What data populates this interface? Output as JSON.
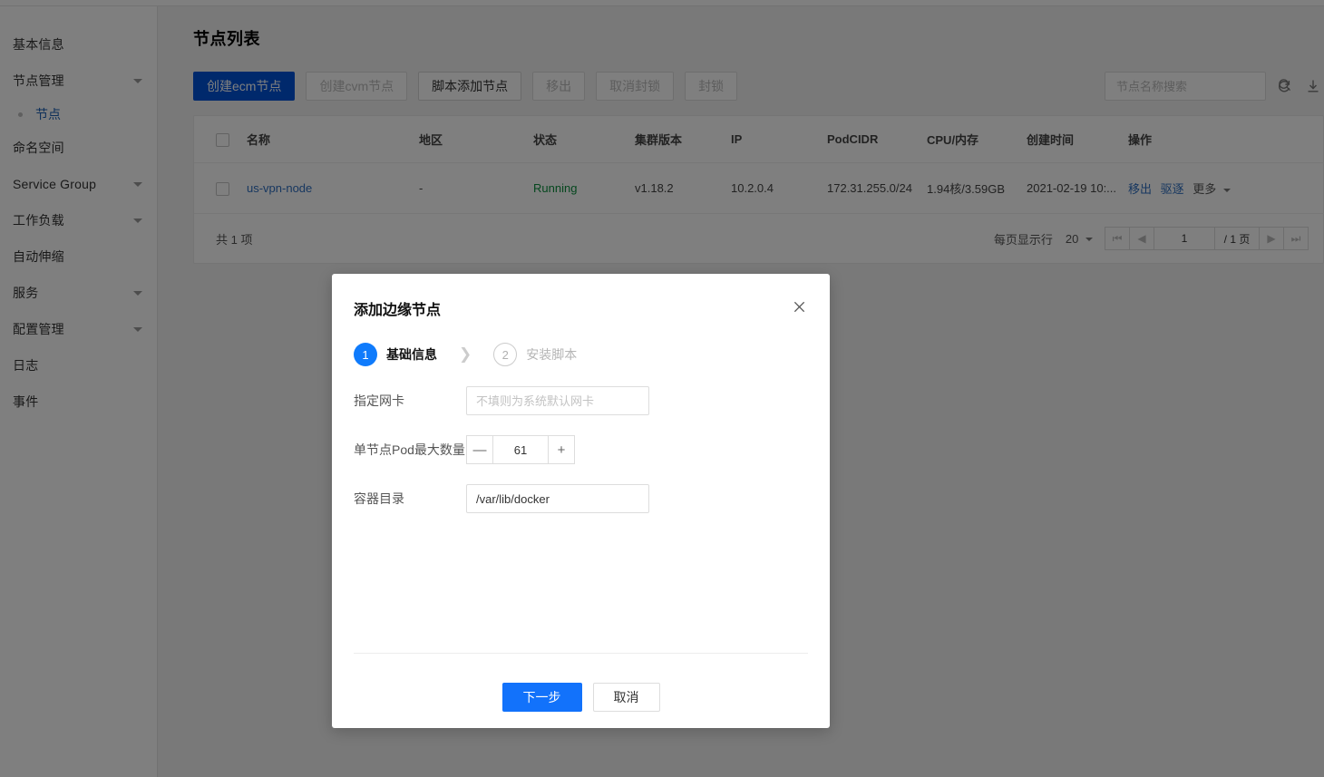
{
  "sidebar": {
    "items": [
      {
        "label": "基本信息",
        "has_caret": false
      },
      {
        "label": "节点管理",
        "has_caret": true
      },
      {
        "label": "命名空间",
        "has_caret": false
      },
      {
        "label": "Service Group",
        "has_caret": true
      },
      {
        "label": "工作负载",
        "has_caret": true
      },
      {
        "label": "自动伸缩",
        "has_caret": false
      },
      {
        "label": "服务",
        "has_caret": true
      },
      {
        "label": "配置管理",
        "has_caret": true
      },
      {
        "label": "日志",
        "has_caret": false
      },
      {
        "label": "事件",
        "has_caret": false
      }
    ],
    "sub_item": {
      "label": "节点"
    }
  },
  "page": {
    "title": "节点列表"
  },
  "toolbar": {
    "create_ecm": "创建ecm节点",
    "create_cvm": "创建cvm节点",
    "script_add": "脚本添加节点",
    "remove": "移出",
    "uncordon": "取消封锁",
    "cordon": "封锁"
  },
  "search": {
    "placeholder": "节点名称搜索",
    "value": "",
    "search_icon": "search-icon",
    "refresh_icon": "refresh-icon",
    "download_icon": "download-icon"
  },
  "table": {
    "columns": [
      "名称",
      "地区",
      "状态",
      "集群版本",
      "IP",
      "PodCIDR",
      "CPU/内存",
      "创建时间",
      "操作"
    ],
    "rows": [
      {
        "name": "us-vpn-node",
        "region": "-",
        "status": "Running",
        "version": "v1.18.2",
        "ip": "10.2.0.4",
        "podcidr": "172.31.255.0/24",
        "cpu_mem": "1.94核/3.59GB",
        "created": "2021-02-19 10:...",
        "actions": {
          "remove": "移出",
          "drain": "驱逐",
          "more": "更多"
        }
      }
    ]
  },
  "pager": {
    "total": "共 1 项",
    "per_page_label": "每页显示行",
    "per_page_value": "20",
    "current_page": "1",
    "total_pages": "/ 1 页",
    "first": "⏮",
    "prev": "◀",
    "next": "▶",
    "last": "⏭"
  },
  "modal": {
    "title": "添加边缘节点",
    "close_icon": "close-icon",
    "steps": [
      {
        "num": "1",
        "label": "基础信息"
      },
      {
        "num": "2",
        "label": "安装脚本"
      }
    ],
    "fields": {
      "nic_label": "指定网卡",
      "nic_placeholder": "不填则为系统默认网卡",
      "nic_value": "",
      "maxpods_label": "单节点Pod最大数量",
      "maxpods_value": "61",
      "minus": "—",
      "plus": "+",
      "dir_label": "容器目录",
      "dir_value": "/var/lib/docker"
    },
    "buttons": {
      "next": "下一步",
      "cancel": "取消"
    }
  },
  "colors": {
    "primary_blue": "#0052d9",
    "modal_blue": "#1272fb",
    "link_blue": "#2f6fc0",
    "status_green": "#0a8f3c"
  }
}
